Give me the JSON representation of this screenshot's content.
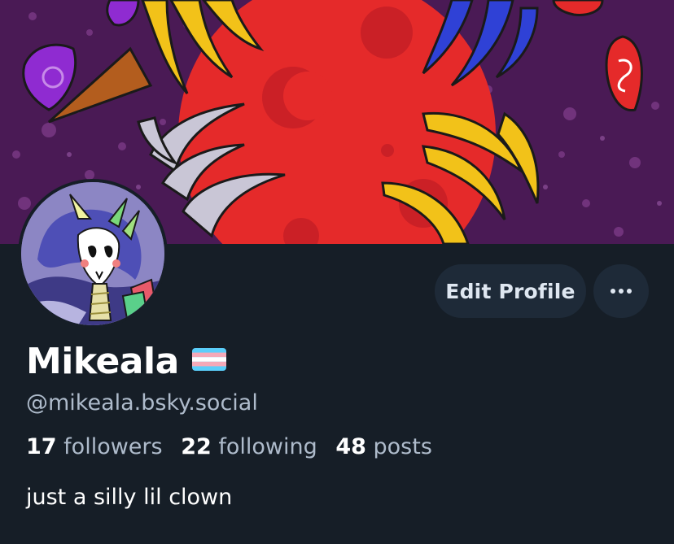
{
  "colors": {
    "background": "#161e27",
    "button_bg": "#1e2a38",
    "secondary_text": "#aebbcb",
    "banner_bg": "#4a1a55",
    "banner_moon": "#e52a2a"
  },
  "banner": {
    "image": "cosmic-red-moon-banner"
  },
  "avatar": {
    "image": "clown-character-avatar"
  },
  "actions": {
    "edit_profile_label": "Edit Profile",
    "more_icon": "ellipsis-icon"
  },
  "profile": {
    "display_name": "Mikeala",
    "flag_icon": "trans-flag-icon",
    "handle": "@mikeala.bsky.social",
    "bio": "just a silly lil clown"
  },
  "stats": {
    "followers_count": "17",
    "followers_label": "followers",
    "following_count": "22",
    "following_label": "following",
    "posts_count": "48",
    "posts_label": "posts"
  }
}
